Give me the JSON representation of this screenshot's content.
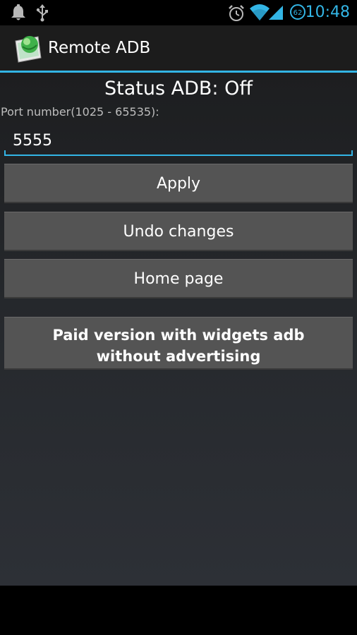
{
  "status_bar": {
    "time": "10:48",
    "battery_level": "62",
    "icons": [
      "notification-bell-icon",
      "usb-icon",
      "alarm-clock-icon",
      "wifi-icon",
      "signal-icon",
      "battery-icon"
    ],
    "accent_color": "#33b5e5"
  },
  "action_bar": {
    "title": "Remote ADB",
    "icon": "remote-adb-app-icon"
  },
  "main": {
    "status": "Status ADB: Off",
    "port_label": "Port number(1025 - 65535):",
    "port_value": "5555",
    "buttons": {
      "apply": "Apply",
      "undo": "Undo changes",
      "home": "Home page",
      "paid": "Paid version with widgets adb without advertising"
    }
  },
  "colors": {
    "accent": "#33b5e5",
    "button_bg": "#545454",
    "action_bar_bg": "#1c1c1c"
  }
}
